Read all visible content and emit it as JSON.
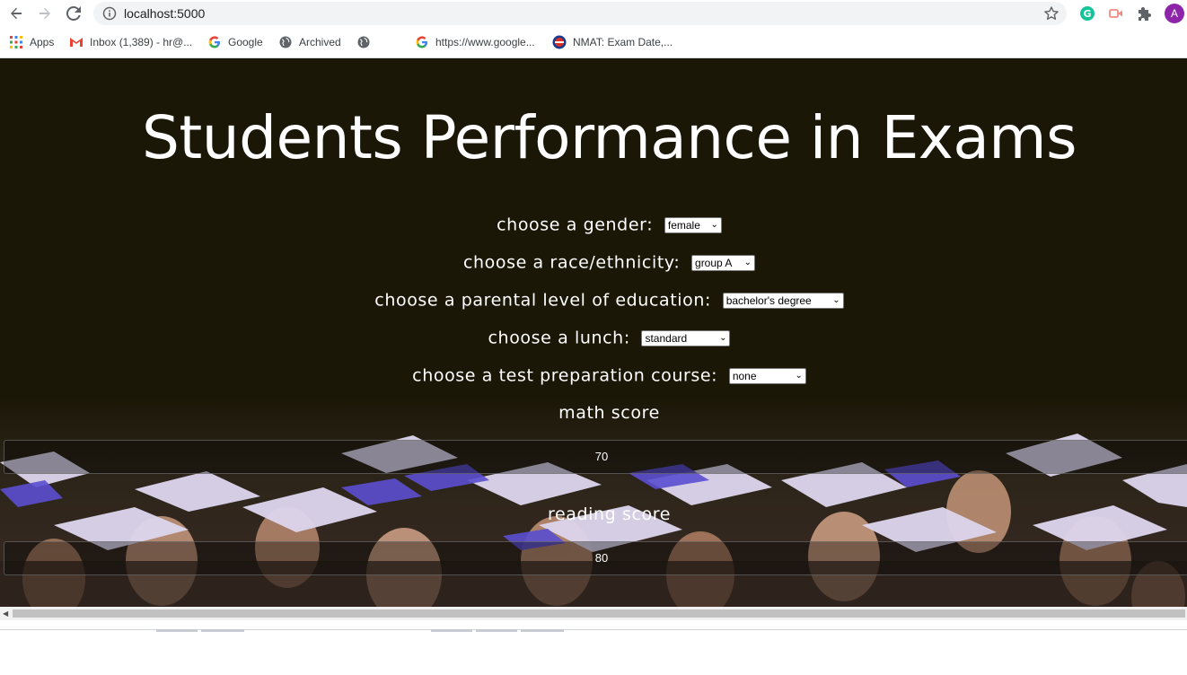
{
  "browser": {
    "url": "localhost:5000",
    "bookmarks": [
      {
        "label": "Apps",
        "icon": "apps-grid-icon"
      },
      {
        "label": "Inbox (1,389) - hr@...",
        "icon": "gmail-icon"
      },
      {
        "label": "Google",
        "icon": "google-icon"
      },
      {
        "label": "Archived",
        "icon": "globe-icon"
      },
      {
        "label": "",
        "icon": "globe-icon"
      },
      {
        "label": "https://www.google...",
        "icon": "google-icon"
      },
      {
        "label": "NMAT: Exam Date,...",
        "icon": "nmat-icon"
      }
    ],
    "avatar_letter": "A",
    "extension_icons": [
      "grammarly-icon",
      "screencast-icon",
      "extensions-puzzle-icon"
    ]
  },
  "page": {
    "title": "Students Performance in Exams",
    "fields": [
      {
        "label": "choose a gender:",
        "value": "female"
      },
      {
        "label": "choose a race/ethnicity:",
        "value": "group A"
      },
      {
        "label": "choose a parental level of education:",
        "value": "bachelor's degree"
      },
      {
        "label": "choose a lunch:",
        "value": "standard"
      },
      {
        "label": "choose a test preparation course:",
        "value": "none"
      }
    ],
    "math_score": {
      "label": "math score",
      "value": "70"
    },
    "reading_score": {
      "label": "reading score",
      "value": "80"
    }
  },
  "colors": {
    "page_background": "#1b1707",
    "title_text": "#ffffff",
    "avatar": "#8e24aa",
    "grammarly": "#15c39a"
  }
}
